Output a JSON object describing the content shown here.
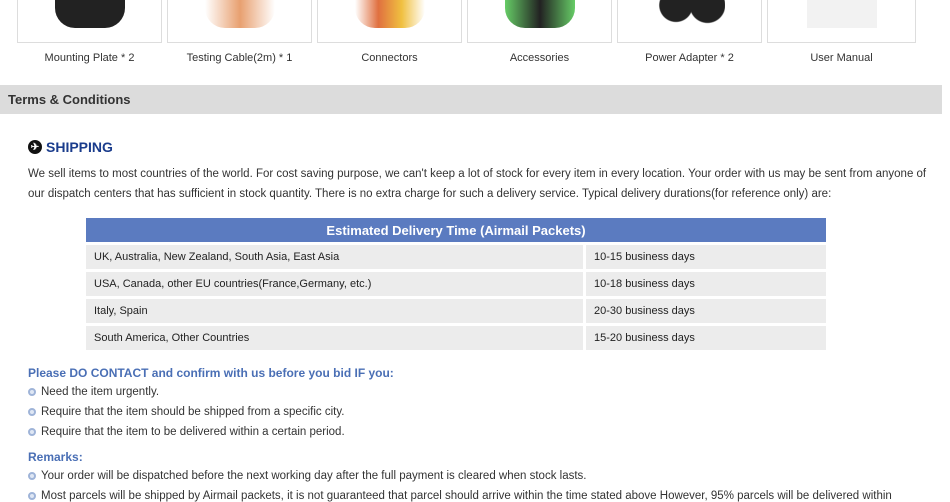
{
  "products": [
    {
      "label": "Mounting Plate * 2"
    },
    {
      "label": "Testing Cable(2m) * 1"
    },
    {
      "label": "Connectors"
    },
    {
      "label": "Accessories"
    },
    {
      "label": "Power Adapter * 2"
    },
    {
      "label": "User Manual"
    }
  ],
  "terms": {
    "title": "Terms & Conditions"
  },
  "shipping": {
    "title": "SHIPPING",
    "icon": "airplane-icon",
    "text": "We sell items to most countries of the world. For cost saving purpose, we can't keep a lot of stock for every item in every location. Your order with us may be sent from anyone of our dispatch centers that has sufficient in stock quantity. There is no extra charge for such a delivery service. Typical delivery durations(for reference only) are:"
  },
  "table": {
    "header": "Estimated Delivery Time (Airmail Packets)",
    "rows": [
      {
        "region": "UK, Australia, New Zealand, South Asia, East Asia",
        "time": "10-15 business days"
      },
      {
        "region": "USA, Canada, other EU countries(France,Germany, etc.)",
        "time": "10-18 business days"
      },
      {
        "region": "Italy, Spain",
        "time": "20-30 business days"
      },
      {
        "region": "South America, Other Countries",
        "time": "15-20 business days"
      }
    ]
  },
  "contact": {
    "heading": "Please DO CONTACT and confirm with us before you bid IF you:",
    "items": [
      "Need the item urgently.",
      "Require that the item should be shipped from a specific city.",
      "Require that the item to be delivered within a certain period."
    ]
  },
  "remarks": {
    "heading": "Remarks:",
    "items": [
      "Your order will be dispatched before the next working day after the full payment is cleared when stock lasts.",
      "Most parcels will be shipped by Airmail packets, it is not guaranteed that parcel should arrive within the time stated above However, 95% parcels will be delivered within"
    ]
  }
}
